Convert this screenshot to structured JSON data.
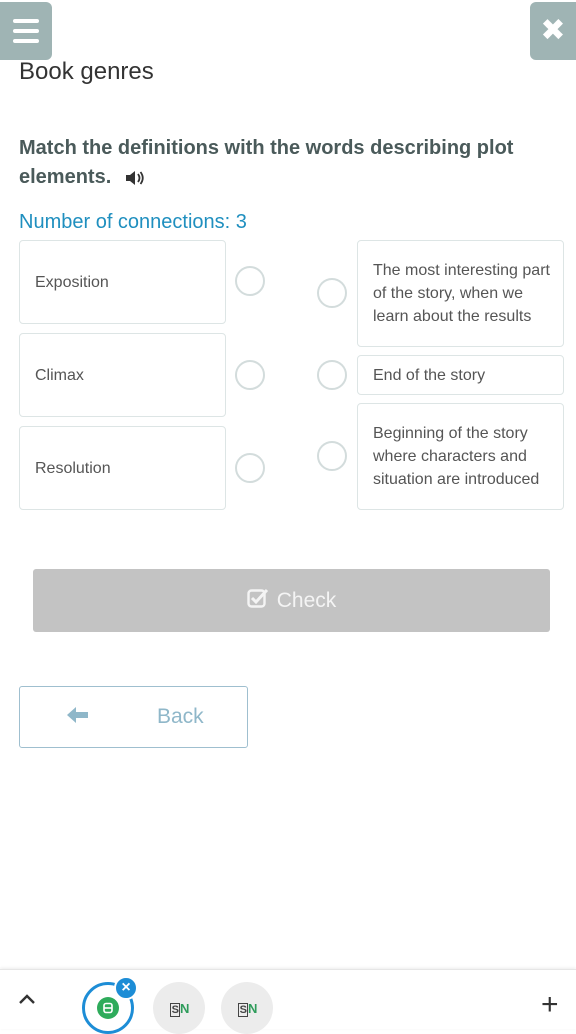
{
  "header": {
    "title": "Book genres"
  },
  "instruction": "Match the definitions with the words describing plot elements.",
  "connections_text": "Number of connections: 3",
  "left_items": [
    {
      "label": "Exposition"
    },
    {
      "label": "Climax"
    },
    {
      "label": "Resolution"
    }
  ],
  "right_items": [
    {
      "label": "The most interesting part of the story, when we learn about the results"
    },
    {
      "label": "End of the story"
    },
    {
      "label": "Beginning of the story where characters and situation are introduced"
    }
  ],
  "buttons": {
    "check": "Check",
    "back": "Back"
  },
  "bottom_bar": {
    "tabs": [
      {
        "icon": "app-b-icon",
        "letter": "B",
        "active": true
      },
      {
        "icon": "sn-icon",
        "text_s": "S",
        "text_n": "N"
      },
      {
        "icon": "sn-icon",
        "text_s": "S",
        "text_n": "N"
      }
    ]
  },
  "colors": {
    "accent": "#1f8fbf",
    "header_button": "#9fb4b4",
    "check_disabled": "#c3c3c3",
    "active_tab_ring": "#1d8dd6"
  }
}
